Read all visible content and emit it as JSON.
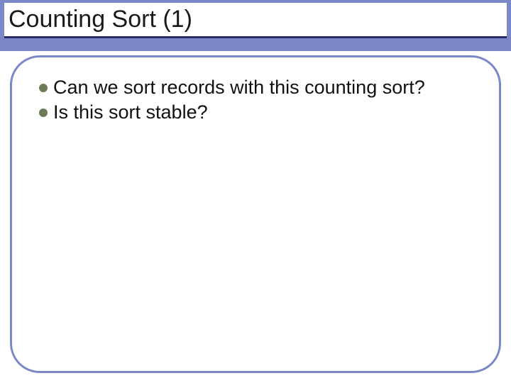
{
  "slide": {
    "title": "Counting Sort (1)",
    "bullets": [
      {
        "text": "Can we sort records with this counting sort?"
      },
      {
        "text": "Is this sort stable?"
      }
    ]
  }
}
